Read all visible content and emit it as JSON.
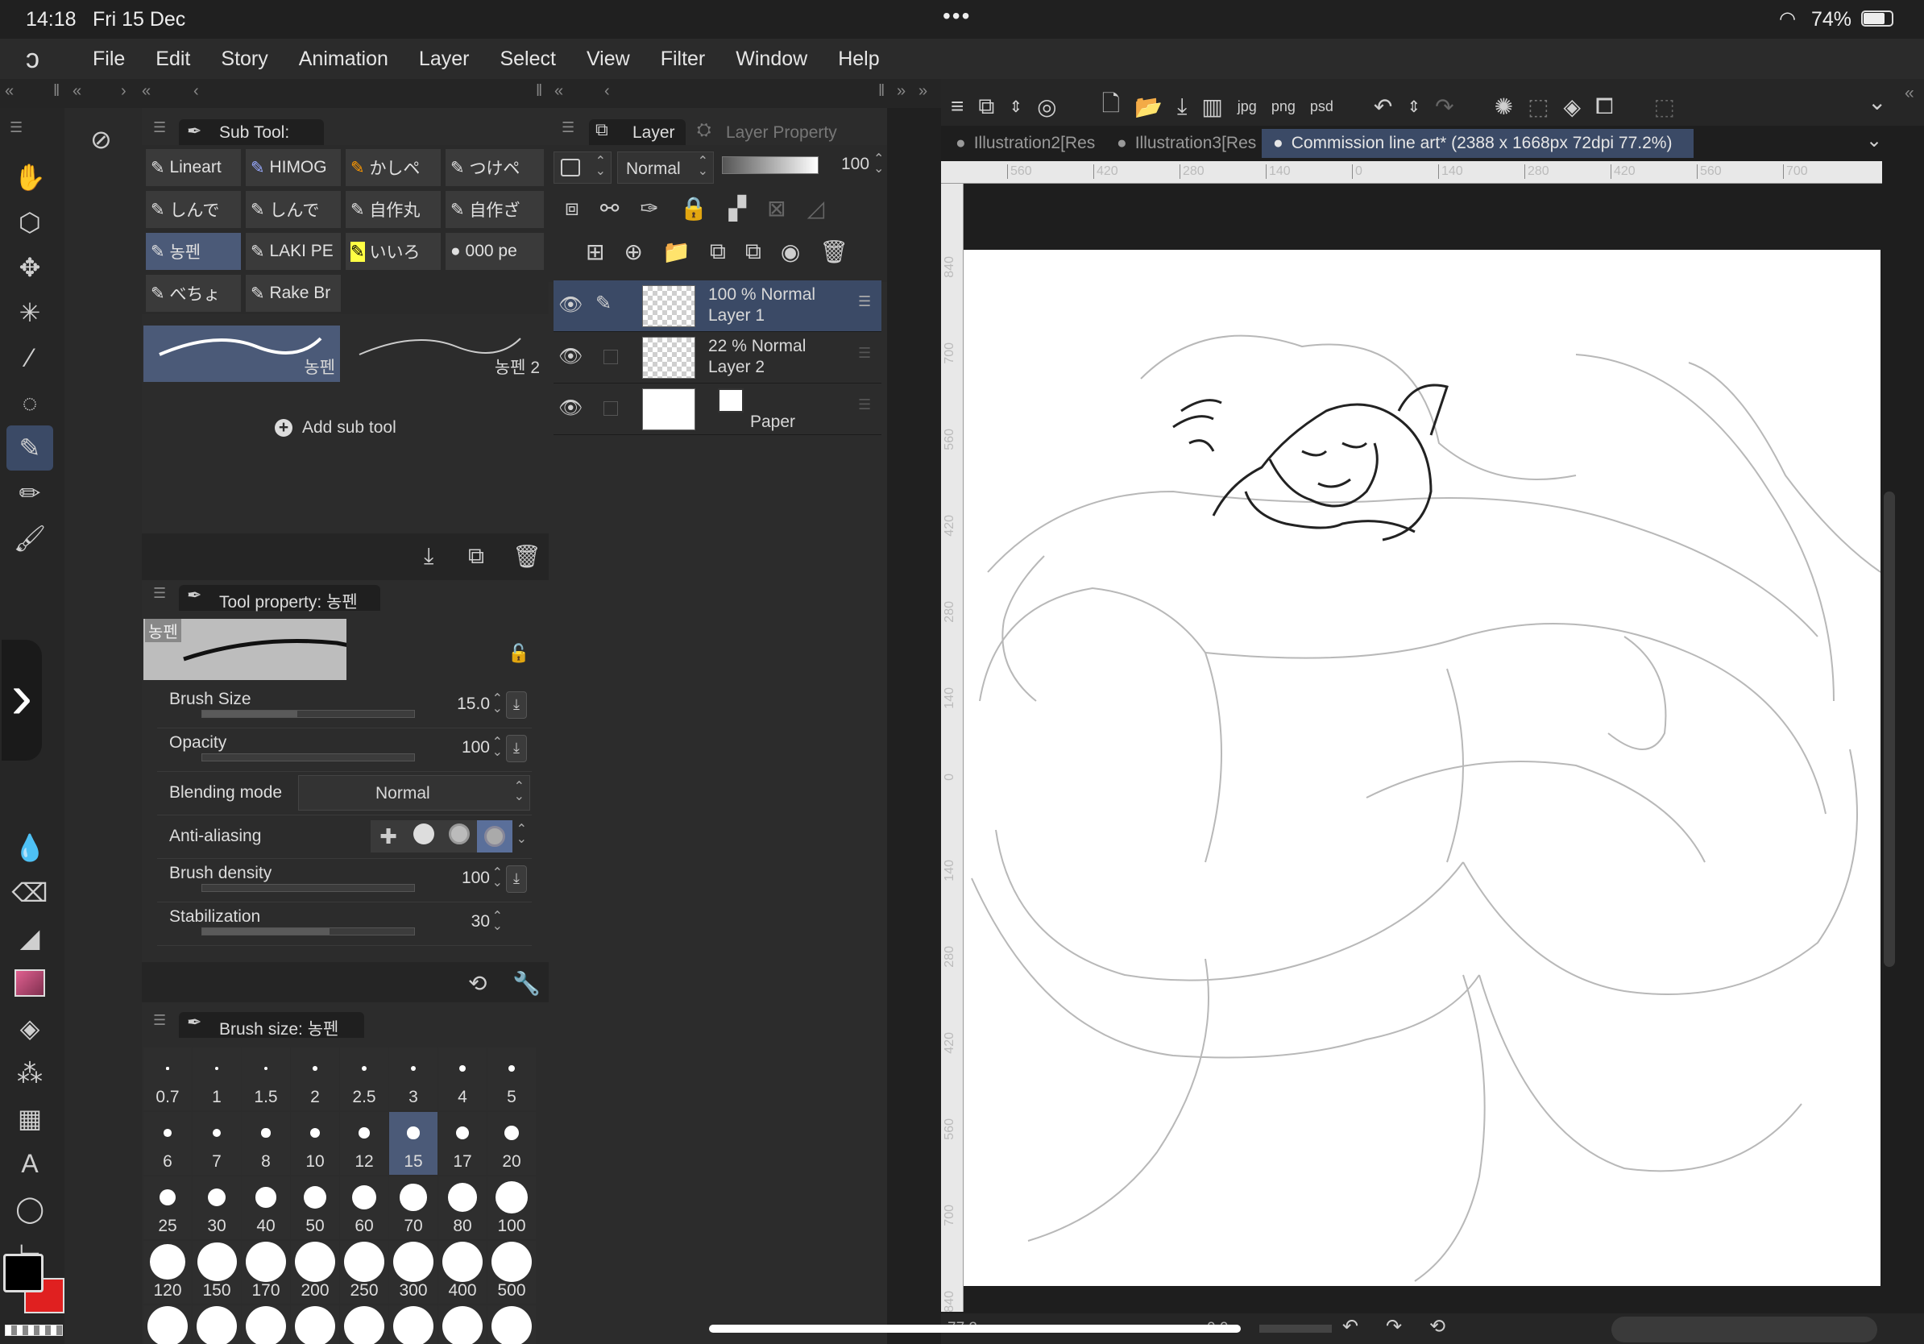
{
  "status": {
    "time": "14:18",
    "date": "Fri 15 Dec",
    "battery": "74%",
    "dots": "•••"
  },
  "menu": [
    "File",
    "Edit",
    "Story",
    "Animation",
    "Layer",
    "Select",
    "View",
    "Filter",
    "Window",
    "Help"
  ],
  "subtool_panel": {
    "title": "Sub Tool: Pen",
    "groups": [
      "Lineart",
      "HIMOG",
      "かしペ",
      "つけペ",
      "しんで",
      "しんで",
      "自作丸",
      "自作ざ",
      "농펜",
      "LAKI PE",
      "いいろ",
      "000 pe",
      "べちょ",
      "Rake Br"
    ],
    "brushes": [
      "농펜",
      "농펜 2"
    ],
    "add_label": "Add sub tool"
  },
  "tool_property": {
    "title": "Tool property: 농펜",
    "preview_label": "농펜",
    "brush_size": {
      "label": "Brush Size",
      "value": "15.0",
      "fill": 0.45
    },
    "opacity": {
      "label": "Opacity",
      "value": "100",
      "fill": 0
    },
    "blending": {
      "label": "Blending mode",
      "value": "Normal"
    },
    "anti_aliasing": {
      "label": "Anti-aliasing"
    },
    "brush_density": {
      "label": "Brush density",
      "value": "100",
      "fill": 0
    },
    "stabilization": {
      "label": "Stabilization",
      "value": "30",
      "fill": 0.6
    }
  },
  "brush_size_panel": {
    "title": "Brush size: 농펜",
    "sizes": [
      "0.7",
      "1",
      "1.5",
      "2",
      "2.5",
      "3",
      "4",
      "5",
      "6",
      "7",
      "8",
      "10",
      "12",
      "15",
      "17",
      "20",
      "25",
      "30",
      "40",
      "50",
      "60",
      "70",
      "80",
      "100",
      "120",
      "150",
      "170",
      "200",
      "250",
      "300",
      "400",
      "500"
    ],
    "selected": "15"
  },
  "layer_panel": {
    "tab_layer": "Layer",
    "tab_property": "Layer Property",
    "blend_mode": "Normal",
    "opacity": "100",
    "layers": [
      {
        "line1": "100 %  Normal",
        "line2": "Layer 1"
      },
      {
        "line1": "22 %  Normal",
        "line2": "Layer 2"
      },
      {
        "line1": "",
        "line2": "Paper"
      }
    ]
  },
  "canvas": {
    "tabs": [
      "Illustration2[Res",
      "Illustration3[Res",
      "Commission line art* (2388 x 1668px 72dpi 77.2%)"
    ],
    "ruler_h": [
      "560",
      "420",
      "280",
      "140",
      "0",
      "140",
      "280",
      "420",
      "560",
      "700"
    ],
    "ruler_v": [
      "840",
      "700",
      "560",
      "420",
      "280",
      "140",
      "0",
      "140",
      "280",
      "420",
      "560",
      "700",
      "840"
    ],
    "footer_zoom": "77.2",
    "footer_angle": "0.0"
  },
  "colors": {
    "accent": "#3b4a66",
    "main_color": "#000000",
    "sub_color": "#e02020"
  }
}
